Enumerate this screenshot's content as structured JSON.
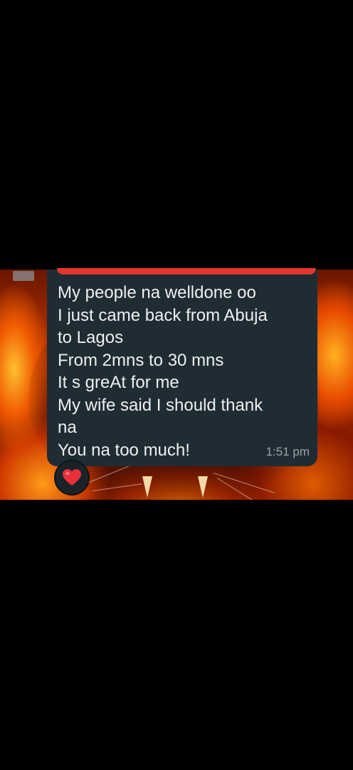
{
  "message": {
    "lines": [
      "My people na welldone oo",
      "I just came back from Abuja",
      "to Lagos",
      "From 2mns to 30 mns",
      "It s greAt for me",
      "My wife said I should thank",
      "na",
      "You na too much!"
    ],
    "time": "1:51 pm"
  },
  "reaction": {
    "icon": "red-heart-icon",
    "color": "#e8303a"
  },
  "colors": {
    "bubble": "#202c33",
    "text": "#eef0f1",
    "timestamp": "#9aa3a8",
    "redaction_mark": "#e2362a",
    "background": "#000000"
  }
}
